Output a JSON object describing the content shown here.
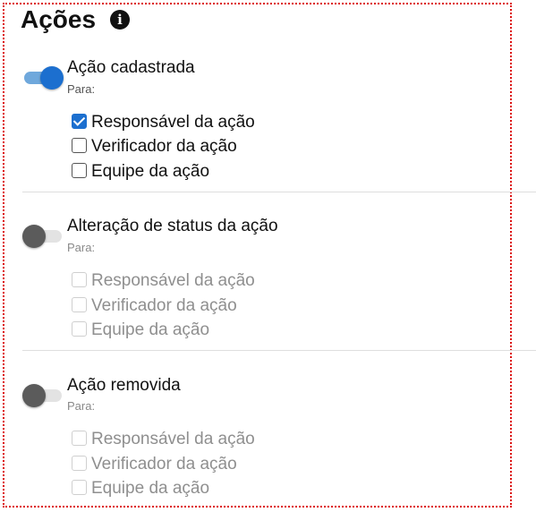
{
  "header": {
    "title": "Ações",
    "info_icon_glyph": "i",
    "info_icon_name": "info-icon"
  },
  "colors": {
    "accent": "#1c6fcf",
    "toggle_on_track": "#6fa8dc",
    "toggle_off_knob": "#5b5b5b",
    "frame_border": "#dd1111"
  },
  "sections": [
    {
      "title": "Ação cadastrada",
      "toggle_on": true,
      "para": "Para:",
      "options": [
        {
          "label": "Responsável da ação",
          "checked": true,
          "disabled": false
        },
        {
          "label": "Verificador da ação",
          "checked": false,
          "disabled": false
        },
        {
          "label": "Equipe da ação",
          "checked": false,
          "disabled": false
        }
      ]
    },
    {
      "title": "Alteração de status da ação",
      "toggle_on": false,
      "para": "Para:",
      "options": [
        {
          "label": "Responsável da ação",
          "checked": false,
          "disabled": true
        },
        {
          "label": "Verificador da ação",
          "checked": false,
          "disabled": true
        },
        {
          "label": "Equipe da ação",
          "checked": false,
          "disabled": true
        }
      ]
    },
    {
      "title": "Ação removida",
      "toggle_on": false,
      "para": "Para:",
      "options": [
        {
          "label": "Responsável da ação",
          "checked": false,
          "disabled": true
        },
        {
          "label": "Verificador da ação",
          "checked": false,
          "disabled": true
        },
        {
          "label": "Equipe da ação",
          "checked": false,
          "disabled": true
        }
      ]
    }
  ]
}
